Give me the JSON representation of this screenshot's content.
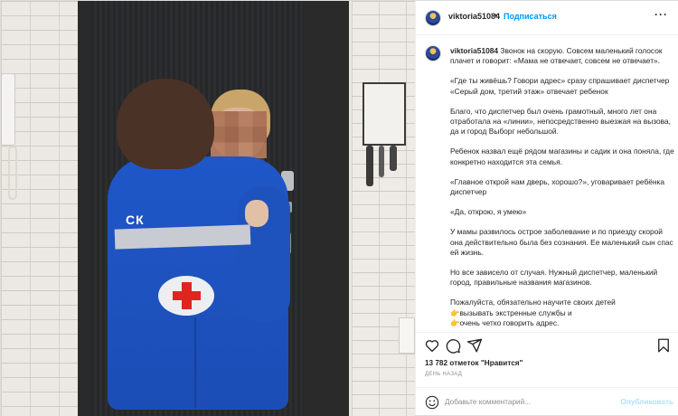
{
  "header": {
    "username": "viktoria51084",
    "dot": "•",
    "follow_label": "Подписаться",
    "more_label": "···"
  },
  "caption": {
    "username": "viktoria51084",
    "paragraphs": [
      "Звонок на скорую. Совсем маленький голосок плачет и говорит: «Мама не отвечает, совсем не отвечает».",
      "«Где ты живёшь? Говори адрес» сразу спрашивает диспетчер «Серый дом, третий этаж» отвечает ребенок",
      "Благо, что диспетчер был очень грамотный, много лет она отработала на «линии», непосредственно выезжая на вызова, да и город Выборг небольшой.",
      "Ребенок назвал ещё рядом магазины и садик и она поняла, где конкретно находится эта семья.",
      "«Главное открой нам дверь, хорошо?», уговаривает ребёнка диспетчер",
      "«Да, открою, я умею»",
      "У мамы развилось острое заболевание и по приезду скорой она действительно была без сознания. Ее маленький сын спас ей жизнь.",
      "Но все зависело от случая. Нужный диспетчер, маленький город, правильные названия магазинов.",
      "Пожалуйста, обязательно научите своих детей"
    ],
    "list_items": [
      "вызывать экстренные службы и",
      "очень четко говорить адрес."
    ],
    "list_emoji": "👉"
  },
  "photo": {
    "jacket_text": "СК"
  },
  "stats": {
    "likes": "13 782 отметок \"Нравится\"",
    "date": "День назад"
  },
  "comment": {
    "placeholder": "Добавьте комментарий...",
    "post_label": "Опубликовать"
  },
  "icons": [
    "heart-icon",
    "comment-icon",
    "share-icon",
    "bookmark-icon",
    "emoji-icon",
    "more-icon"
  ],
  "colors": {
    "follow": "#0095f6",
    "post_disabled": "#b2dffc",
    "jacket": "#1f57c8",
    "cross": "#e0251f"
  }
}
